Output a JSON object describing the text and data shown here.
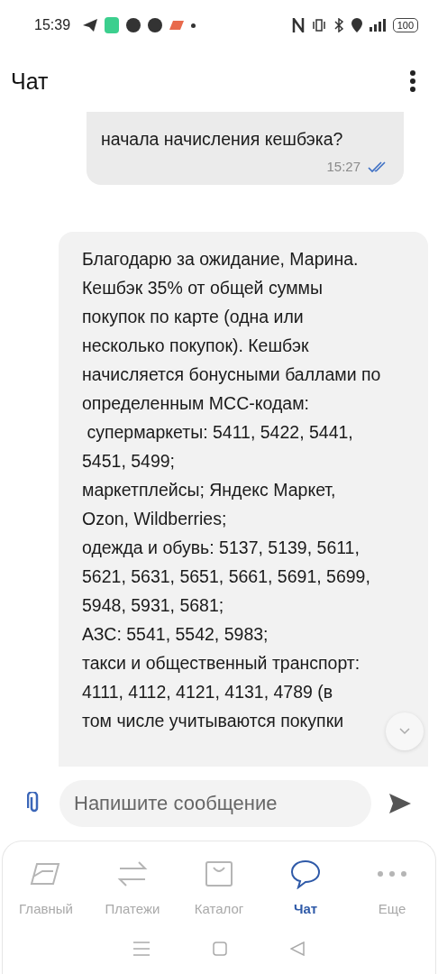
{
  "status_bar": {
    "time": "15:39",
    "battery": "100"
  },
  "header": {
    "title": "Чат"
  },
  "messages": [
    {
      "kind": "outgoing",
      "text": "начала начисления кешбэка?",
      "time": "15:27",
      "read": true
    },
    {
      "kind": "incoming",
      "text": "Благодарю за ожидание, Марина.\nКешбэк 35% от общей суммы\nпокупок по карте (одна или\nнесколько покупок). Кешбэк\nначисляется бонусными баллами по\nопределенным МСС-кодам:\n супермаркеты: 5411, 5422, 5441,\n5451, 5499;\nмаркетплейсы; Яндекс Маркет,\nOzon, Wildberries;\nодежда и обувь: 5137, 5139, 5611,\n5621, 5631, 5651, 5661, 5691, 5699,\n5948, 5931, 5681;\nАЗС: 5541, 5542, 5983;\nтакси и общественный транспорт:\n4111, 4112, 4121, 4131, 4789 (в\nтом числе учитываются покупки"
    }
  ],
  "composer": {
    "placeholder": "Напишите сообщение"
  },
  "nav": [
    {
      "label": "Главный",
      "selected": false
    },
    {
      "label": "Платежи",
      "selected": false
    },
    {
      "label": "Каталог",
      "selected": false
    },
    {
      "label": "Чат",
      "selected": true
    },
    {
      "label": "Еще",
      "selected": false
    }
  ]
}
